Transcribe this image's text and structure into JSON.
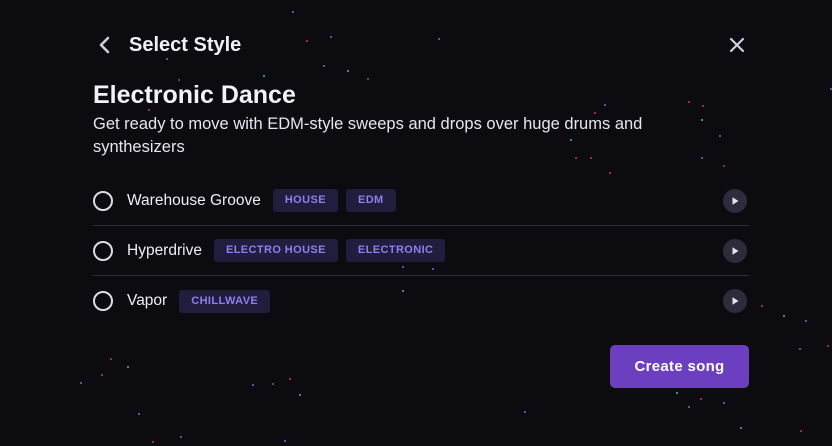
{
  "header": {
    "title": "Select Style",
    "back_icon": "chevron-left-icon",
    "close_icon": "close-icon"
  },
  "genre": {
    "title": "Electronic Dance",
    "description": "Get ready to move with EDM-style sweeps and drops over huge drums and synthesizers"
  },
  "styles": [
    {
      "name": "Warehouse Groove",
      "tags": [
        "HOUSE",
        "EDM"
      ],
      "selected": false
    },
    {
      "name": "Hyperdrive",
      "tags": [
        "ELECTRO HOUSE",
        "ELECTRONIC"
      ],
      "selected": false
    },
    {
      "name": "Vapor",
      "tags": [
        "CHILLWAVE"
      ],
      "selected": false
    }
  ],
  "create_button": {
    "label": "Create song"
  },
  "colors": {
    "background": "#0c0b10",
    "accent": "#6b3fbf",
    "tag_bg": "#211d3c",
    "tag_text": "#8d7ff0",
    "particle_red": "#d8344d",
    "particle_teal": "#2fc9a8",
    "particle_blue": "#6a72d8"
  }
}
